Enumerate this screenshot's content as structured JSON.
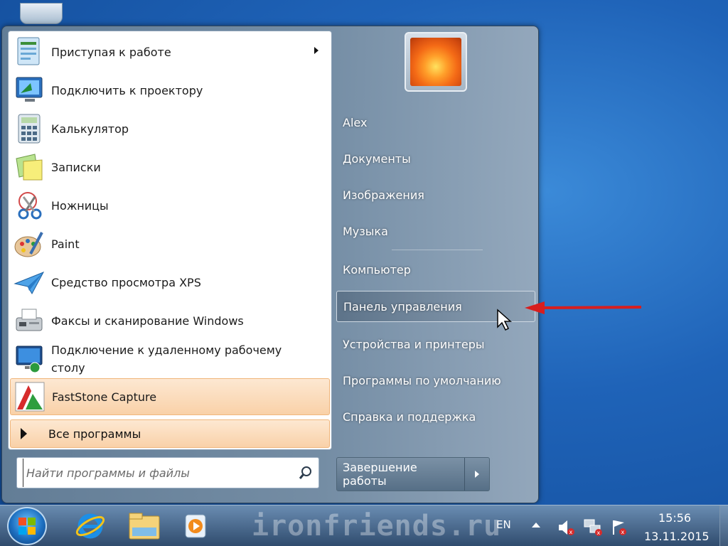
{
  "start_menu": {
    "programs": [
      {
        "label": "Приступая к работе",
        "icon": "getting-started-icon",
        "has_submenu": true
      },
      {
        "label": "Подключить к проектору",
        "icon": "projector-icon"
      },
      {
        "label": "Калькулятор",
        "icon": "calculator-icon"
      },
      {
        "label": "Записки",
        "icon": "sticky-notes-icon"
      },
      {
        "label": "Ножницы",
        "icon": "scissors-icon"
      },
      {
        "label": "Paint",
        "icon": "paint-icon"
      },
      {
        "label": "Средство просмотра XPS",
        "icon": "xps-viewer-icon"
      },
      {
        "label": "Факсы и сканирование Windows",
        "icon": "fax-scan-icon"
      },
      {
        "label_line1": "Подключение к удаленному рабочему",
        "label_line2": "столу",
        "icon": "remote-desktop-icon"
      },
      {
        "label": "FastStone Capture",
        "icon": "faststone-icon",
        "highlighted": true
      }
    ],
    "all_programs_label": "Все программы",
    "search_placeholder": "Найти программы и файлы",
    "user_picture": "flower-user-picture",
    "right_items": [
      {
        "label": "Alex"
      },
      {
        "label": "Документы"
      },
      {
        "label": "Изображения"
      },
      {
        "label": "Музыка"
      },
      {
        "label": "Компьютер"
      },
      {
        "label": "Панель управления",
        "active": true
      },
      {
        "label": "Устройства и принтеры"
      },
      {
        "label": "Программы по умолчанию"
      },
      {
        "label": "Справка и поддержка"
      }
    ],
    "shutdown_label": "Завершение работы"
  },
  "taskbar": {
    "pinned": [
      "internet-explorer-icon",
      "windows-explorer-icon",
      "media-player-icon"
    ],
    "watermark": "ironfriends.ru",
    "language": "EN",
    "tray_icons": [
      "volume-muted-icon",
      "network-disconnected-icon",
      "action-center-icon"
    ],
    "time": "15:56",
    "date": "13.11.2015"
  },
  "colors": {
    "highlight": "#f9d1a8",
    "annotation_arrow": "#d81e1e"
  }
}
